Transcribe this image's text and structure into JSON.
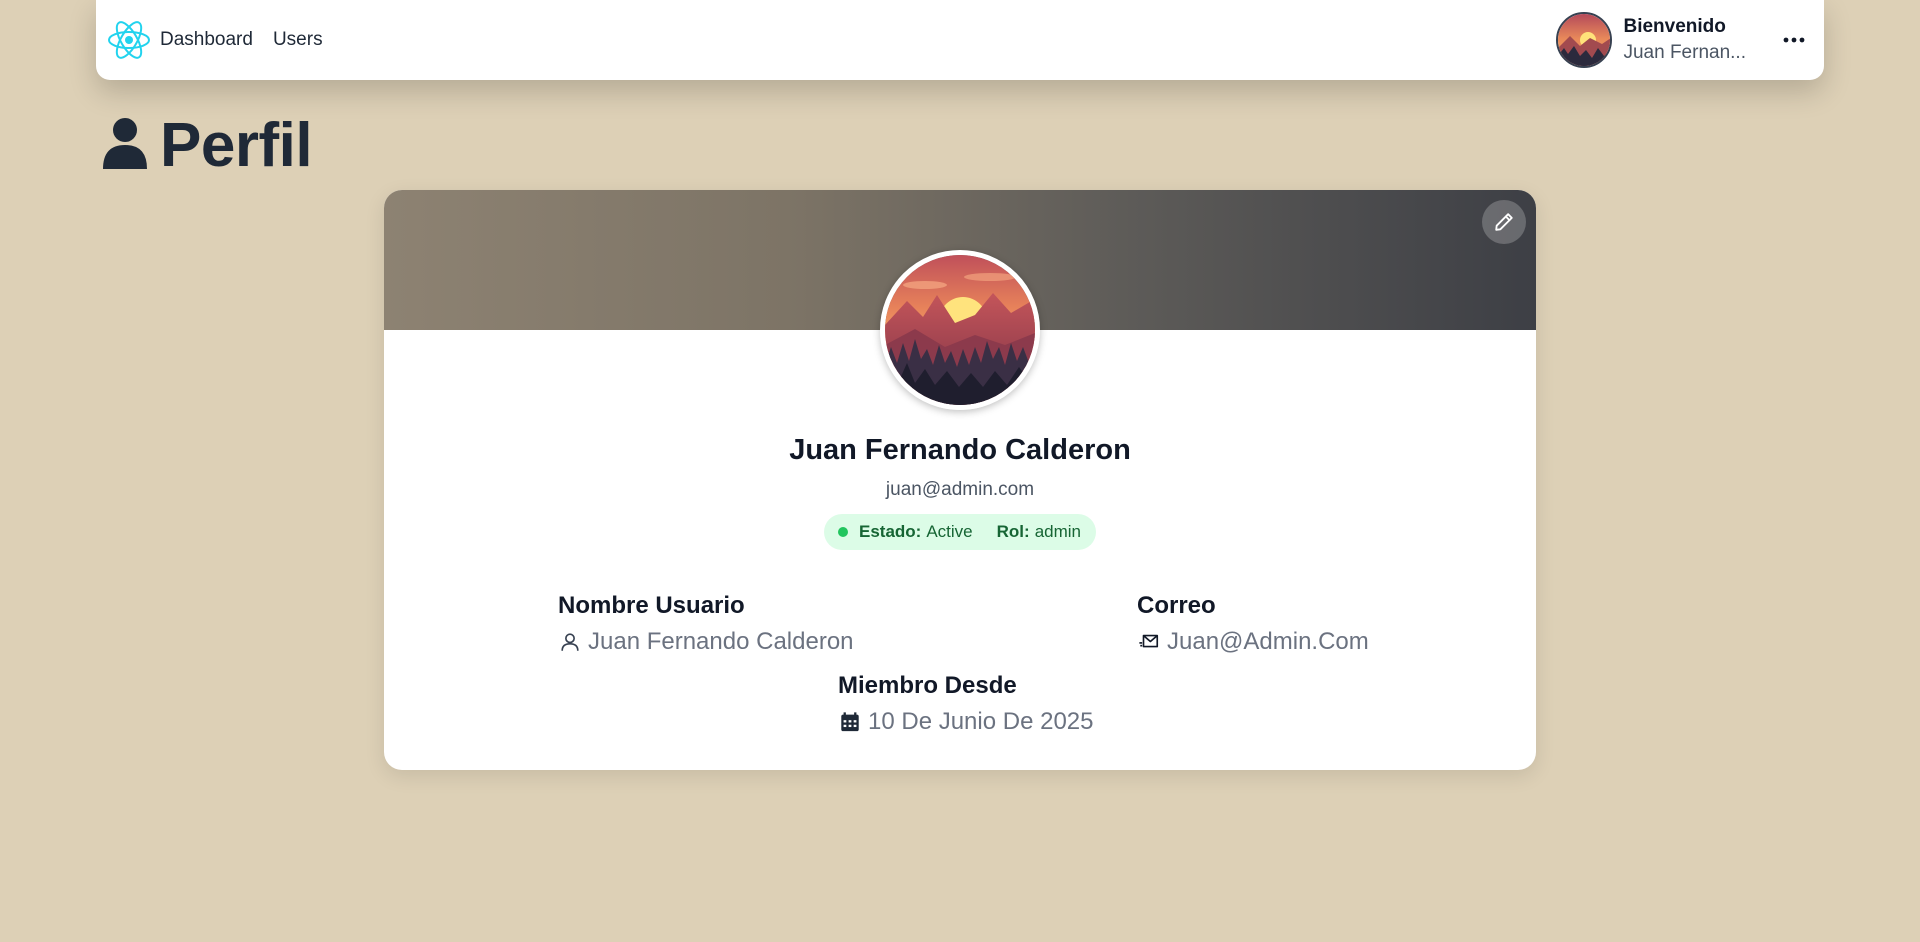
{
  "nav": {
    "logo_icon": "react-atom-icon",
    "links": [
      {
        "label": "Dashboard"
      },
      {
        "label": "Users"
      }
    ],
    "greeting_title": "Bienvenido",
    "greeting_name": "Juan Fernan...",
    "more_icon": "more-horizontal-icon"
  },
  "page": {
    "title": "Perfil",
    "title_icon": "user-icon"
  },
  "profile": {
    "edit_icon": "pencil-icon",
    "name": "Juan Fernando Calderon",
    "email": "juan@admin.com",
    "status_label": "Estado:",
    "status_value": "Active",
    "role_label": "Rol:",
    "role_value": "admin",
    "fields": {
      "username": {
        "label": "Nombre Usuario",
        "value": "Juan Fernando Calderon",
        "icon": "user-outline-icon"
      },
      "email": {
        "label": "Correo",
        "value": "Juan@Admin.Com",
        "icon": "mail-send-icon"
      },
      "member_since": {
        "label": "Miembro Desde",
        "value": "10 De Junio De 2025",
        "icon": "calendar-icon"
      }
    }
  },
  "colors": {
    "background": "#ddd0b6",
    "status_bg": "#dcfce7",
    "status_text": "#166534",
    "status_dot": "#22c55e",
    "react_logo": "#22d3ee"
  }
}
